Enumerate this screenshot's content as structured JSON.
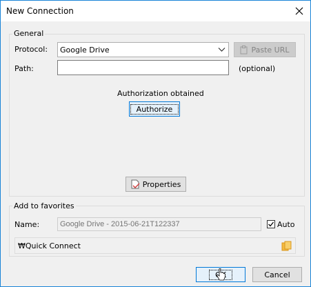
{
  "window": {
    "title": "New Connection"
  },
  "general": {
    "group_label": "General",
    "protocol_label": "Protocol:",
    "protocol_value": "Google Drive",
    "paste_url_label": "Paste URL",
    "path_label": "Path:",
    "path_value": "",
    "optional_label": "(optional)",
    "auth_status": "Authorization obtained",
    "authorize_label": "Authorize",
    "properties_label": "Properties"
  },
  "favorites": {
    "group_label": "Add to favorites",
    "name_label": "Name:",
    "name_placeholder": "Google Drive - 2015-06-21T122337",
    "auto_label": "Auto",
    "auto_checked": true,
    "quick_connect_label": "₩Quick Connect"
  },
  "footer": {
    "ok_label": "OK",
    "cancel_label": "Cancel"
  }
}
